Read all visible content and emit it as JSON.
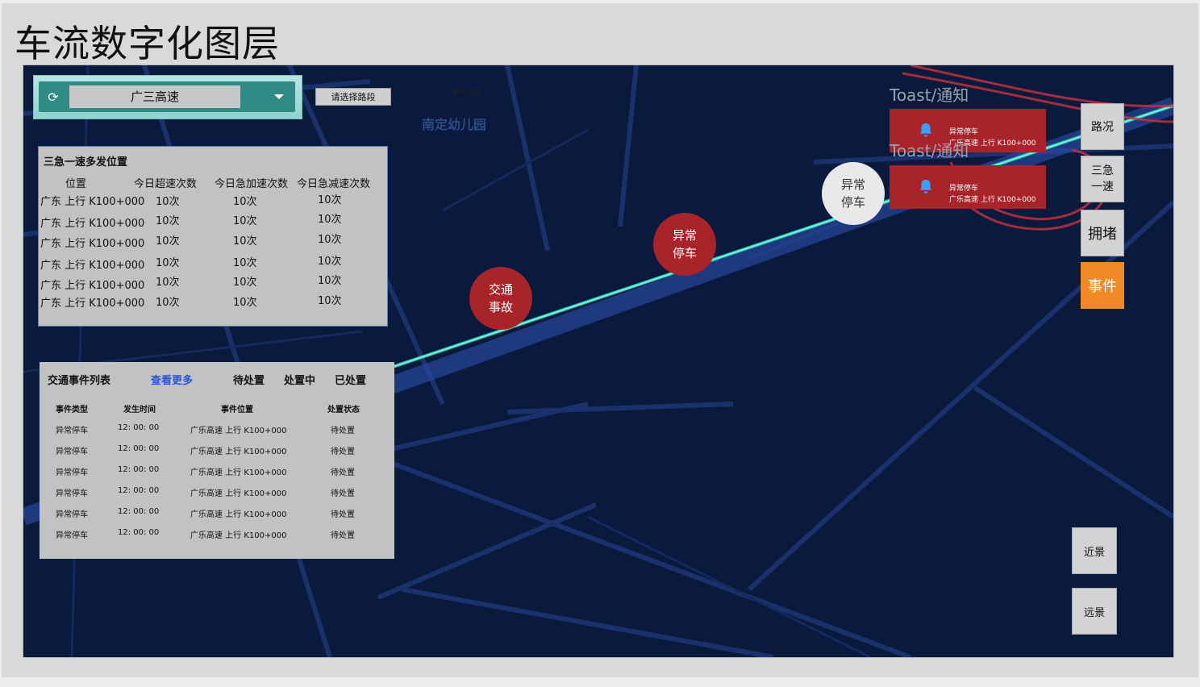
{
  "page_title": "车流数字化图层",
  "route_selector": {
    "value": "广三高速"
  },
  "choose_segment_label": "请选择路段",
  "event_alert_label": "事件告警",
  "map_poi": "南定幼儿园",
  "hotspot_panel": {
    "title": "三急一速多发位置",
    "columns": [
      "位置",
      "今日超速次数",
      "今日急加速次数",
      "今日急减速次数"
    ],
    "rows": [
      [
        "广东 上行 K100+000",
        "10次",
        "10次",
        "10次"
      ],
      [
        "广东 上行 K100+000",
        "10次",
        "10次",
        "10次"
      ],
      [
        "广东 上行 K100+000",
        "10次",
        "10次",
        "10次"
      ],
      [
        "广东 上行 K100+000",
        "10次",
        "10次",
        "10次"
      ],
      [
        "广东 上行 K100+000",
        "10次",
        "10次",
        "10次"
      ],
      [
        "广东 上行 K100+000",
        "10次",
        "10次",
        "10次"
      ]
    ]
  },
  "events_panel": {
    "title": "交通事件列表",
    "more_link": "查看更多",
    "tabs": [
      "待处置",
      "处置中",
      "已处置"
    ],
    "columns": [
      "事件类型",
      "发生时间",
      "事件位置",
      "处置状态"
    ],
    "rows": [
      [
        "异常停车",
        "12: 00: 00",
        "广乐高速 上行 K100+000",
        "待处置"
      ],
      [
        "异常停车",
        "12: 00: 00",
        "广乐高速 上行 K100+000",
        "待处置"
      ],
      [
        "异常停车",
        "12: 00: 00",
        "广乐高速 上行 K100+000",
        "待处置"
      ],
      [
        "异常停车",
        "12: 00: 00",
        "广乐高速 上行 K100+000",
        "待处置"
      ],
      [
        "异常停车",
        "12: 00: 00",
        "广乐高速 上行 K100+000",
        "待处置"
      ],
      [
        "异常停车",
        "12: 00: 00",
        "广乐高速 上行 K100+000",
        "待处置"
      ]
    ]
  },
  "markers": [
    {
      "line1": "交通",
      "line2": "事故",
      "style": "red"
    },
    {
      "line1": "异常",
      "line2": "停车",
      "style": "red"
    },
    {
      "line1": "异常",
      "line2": "停车",
      "style": "white"
    }
  ],
  "toasts": [
    {
      "label": "Toast/通知",
      "title": "异常停车",
      "body": "广乐高速 上行 K100+000"
    },
    {
      "label": "Toast/通知",
      "title": "异常停车",
      "body": "广乐高速 上行 K100+000"
    }
  ],
  "side_buttons": [
    {
      "label": "路况",
      "active": false
    },
    {
      "label": "三急一速",
      "active": false
    },
    {
      "label": "拥堵",
      "active": false
    },
    {
      "label": "事件",
      "active": true
    }
  ],
  "view_buttons": [
    "近景",
    "远景"
  ],
  "colors": {
    "map_bg": "#0a1a3d",
    "road": "#1e3a7a",
    "highway_glow": "#2fc7b0",
    "marker_red": "#a8232a",
    "active_button": "#f08a24",
    "link_blue": "#2a55d6"
  },
  "icons": [
    "refresh-icon",
    "chevron-down-icon",
    "bell-icon"
  ]
}
